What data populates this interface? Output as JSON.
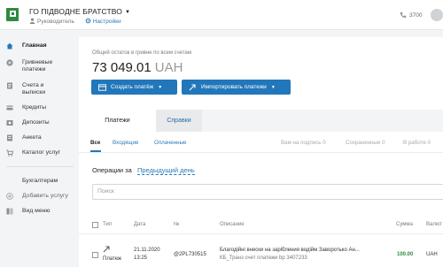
{
  "header": {
    "company": "ГО ПІДВОДНЕ БРАТСТВО",
    "role": "Руководитель",
    "settings": "Настройки",
    "phone": "3700"
  },
  "sidebar": {
    "items": [
      {
        "label": "Главная",
        "icon": "home-icon"
      },
      {
        "label": "Гривневые платежи",
        "icon": "hryvnia-icon"
      },
      {
        "label": "Счета и выписки",
        "icon": "statements-icon"
      },
      {
        "label": "Кредиты",
        "icon": "credit-icon"
      },
      {
        "label": "Депозиты",
        "icon": "deposit-icon"
      },
      {
        "label": "Анкета",
        "icon": "form-icon"
      },
      {
        "label": "Каталог услуг",
        "icon": "cart-icon"
      }
    ],
    "accountants": "Бухгалтерам",
    "add_service": "Добавить услугу",
    "view_menu": "Вид меню"
  },
  "main": {
    "balance_caption": "Общий остаток в гривне по всем счетам",
    "balance_value": "73 049.01",
    "balance_currency": "UAH",
    "create_button": "Создать платёж",
    "import_button": "Импортировать платежи",
    "tabs": [
      "Платежи",
      "Справки"
    ],
    "subtabs": {
      "all": "Все",
      "incoming": "Входящие",
      "paid": "Оплаченные",
      "awaiting": "Вам на подпись",
      "awaiting_count": "0",
      "saved": "Сохраненные",
      "saved_count": "0",
      "in_work": "В работе",
      "in_work_count": "0"
    },
    "operations_label": "Операции за",
    "period_link": "Предыдущий день",
    "search_placeholder": "Поиск",
    "table": {
      "headers": {
        "type": "Тип",
        "date": "Дата",
        "number": "№",
        "description": "Описание",
        "sum": "Сумма",
        "currency": "Валют"
      },
      "rows": [
        {
          "type": "Платеж",
          "date": "21.11.2020",
          "time": "13:25",
          "number": "@2PL730515",
          "description": "Благодійні внески на зарібления водійм Заворотько Ан...",
          "description2": "КБ_Транз счет платежи bp 3407233",
          "sum": "100.00",
          "currency": "UAH"
        }
      ]
    }
  },
  "colors": {
    "accent": "#2277bb",
    "brand": "#2e8b3d",
    "link": "#2b7bb9"
  }
}
